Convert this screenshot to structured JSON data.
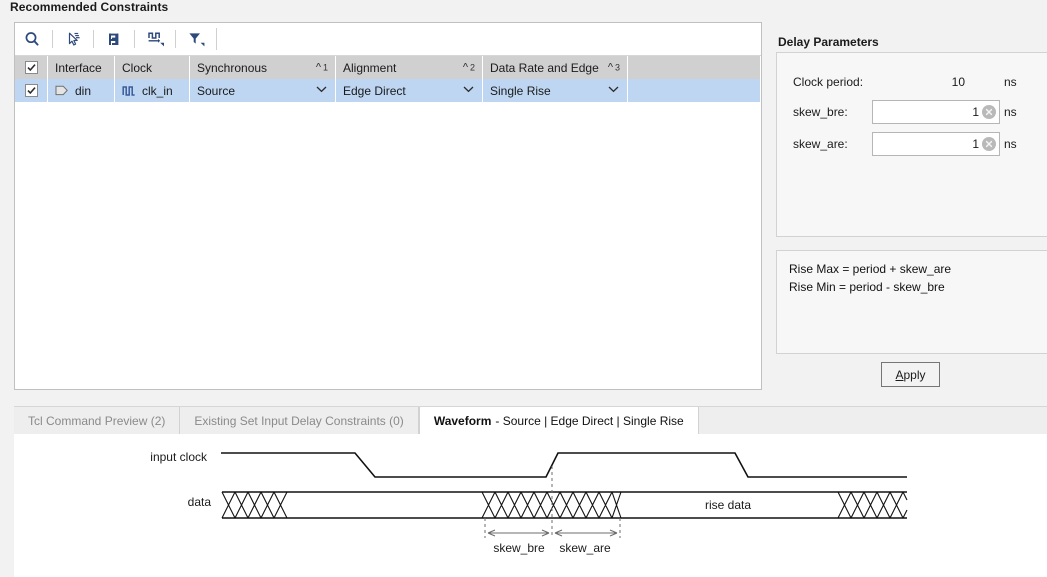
{
  "panel": {
    "title": "Recommended Constraints"
  },
  "toolbar": {
    "buttons": [
      {
        "name": "search-icon",
        "tooltip": "Search"
      },
      {
        "name": "select-cursor-icon",
        "tooltip": "Select"
      },
      {
        "name": "collapse-icon",
        "tooltip": "Collapse"
      },
      {
        "name": "clock-waveform-icon",
        "tooltip": "Clock"
      },
      {
        "name": "filter-icon",
        "tooltip": "Filter"
      }
    ]
  },
  "table": {
    "columns": [
      {
        "label": "",
        "key": "check"
      },
      {
        "label": "Interface",
        "key": "interface"
      },
      {
        "label": "Clock",
        "key": "clock"
      },
      {
        "label": "Synchronous",
        "key": "synchronous",
        "sort": "1"
      },
      {
        "label": "Alignment",
        "key": "alignment",
        "sort": "2"
      },
      {
        "label": "Data Rate and Edge",
        "key": "rate",
        "sort": "3"
      }
    ],
    "header_checkbox_checked": true,
    "rows": [
      {
        "checked": true,
        "interface": "din",
        "interface_icon": "port-icon",
        "clock": "clk_in",
        "clock_icon": "clock-icon",
        "synchronous": "Source",
        "alignment": "Edge Direct",
        "rate": "Single Rise",
        "selected": true
      }
    ]
  },
  "delay_parameters": {
    "title": "Delay Parameters",
    "clock_period_label": "Clock period:",
    "clock_period_value": "10",
    "clock_period_unit": "ns",
    "skew_bre_label": "skew_bre:",
    "skew_bre_value": "1",
    "skew_bre_unit": "ns",
    "skew_are_label": "skew_are:",
    "skew_are_value": "1",
    "skew_are_unit": "ns",
    "clear_icon": "clear-circle-icon"
  },
  "formula": {
    "lines": [
      "Rise Max = period + skew_are",
      "Rise Min = period - skew_bre"
    ]
  },
  "apply": {
    "label": "Apply",
    "mnemonic": "A",
    "rest": "pply"
  },
  "tabs": [
    {
      "label": "Tcl Command Preview (2)",
      "active": false
    },
    {
      "label": "Existing Set Input Delay Constraints (0)",
      "active": false
    },
    {
      "label": "Waveform - Source | Edge Direct | Single Rise",
      "active": true,
      "strong": "Waveform",
      "rest": "- Source | Edge Direct | Single Rise"
    }
  ],
  "waveform": {
    "clock_label": "input clock",
    "data_label": "data",
    "data_value_label": "rise data",
    "skew_bre_label": "skew_bre",
    "skew_are_label": "skew_are"
  },
  "colors": {
    "accent_icon": "#2e4a7d",
    "row_selected": "#bed6f2",
    "header_gray": "#d0d0d0",
    "panel_bg": "#f2f2f2",
    "tab_inactive_text": "#8a8a8a"
  }
}
